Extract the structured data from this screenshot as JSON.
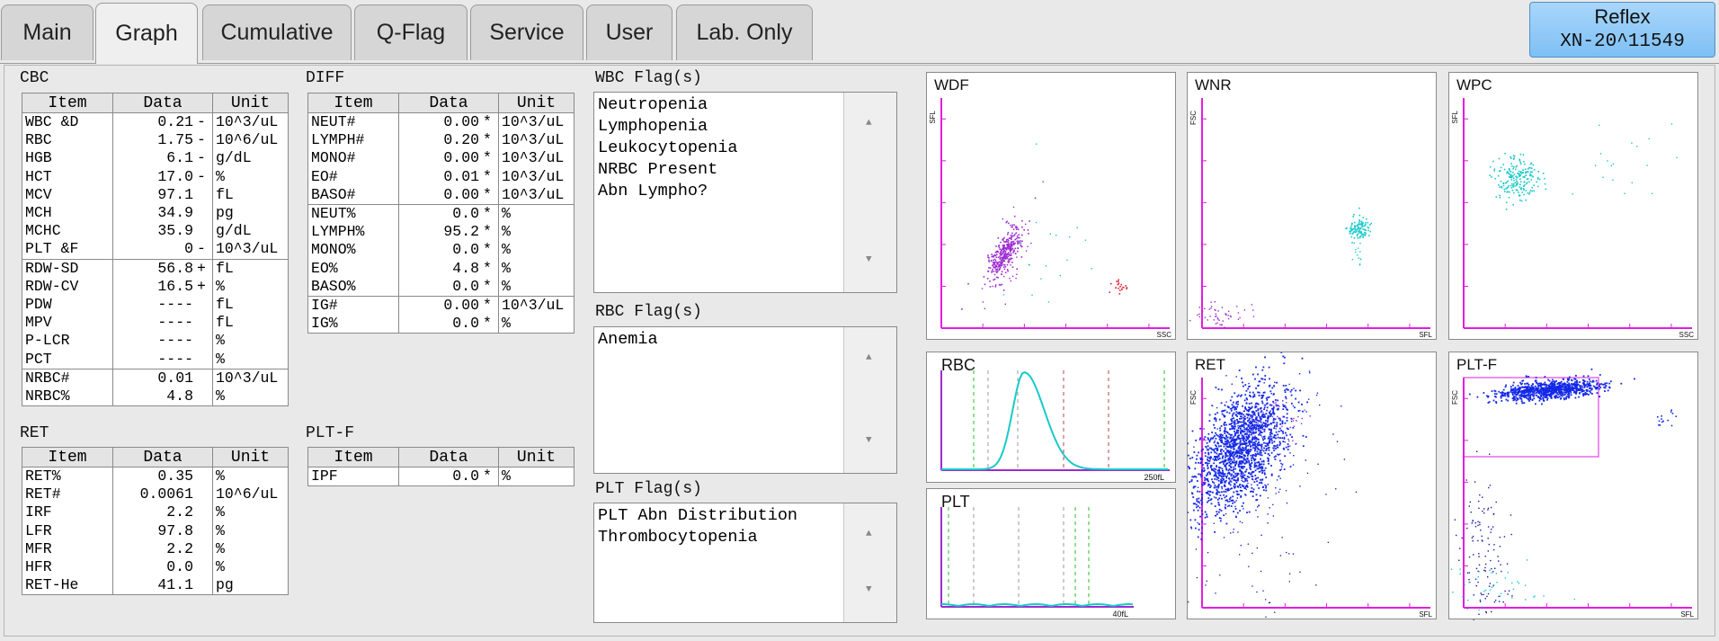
{
  "tabs": [
    {
      "label": "Main",
      "active": false
    },
    {
      "label": "Graph",
      "active": true
    },
    {
      "label": "Cumulative",
      "active": false
    },
    {
      "label": "Q-Flag",
      "active": false
    },
    {
      "label": "Service",
      "active": false
    },
    {
      "label": "User",
      "active": false
    },
    {
      "label": "Lab. Only",
      "active": false
    }
  ],
  "reflex": {
    "label": "Reflex",
    "analyzer": "XN-20^11549"
  },
  "table_headers": {
    "item": "Item",
    "data": "Data",
    "unit": "Unit"
  },
  "cbc": {
    "title": "CBC",
    "rows": [
      {
        "item": "WBC &D",
        "data": "0.21",
        "flag": "-",
        "unit": "10^3/uL"
      },
      {
        "item": "RBC",
        "data": "1.75",
        "flag": "-",
        "unit": "10^6/uL"
      },
      {
        "item": "HGB",
        "data": "6.1",
        "flag": "-",
        "unit": "g/dL"
      },
      {
        "item": "HCT",
        "data": "17.0",
        "flag": "-",
        "unit": "%"
      },
      {
        "item": "MCV",
        "data": "97.1",
        "flag": "",
        "unit": "fL"
      },
      {
        "item": "MCH",
        "data": "34.9",
        "flag": "",
        "unit": "pg"
      },
      {
        "item": "MCHC",
        "data": "35.9",
        "flag": "",
        "unit": "g/dL"
      },
      {
        "item": "PLT &F",
        "data": "0",
        "flag": "-",
        "unit": "10^3/uL"
      },
      {
        "item": "RDW-SD",
        "data": "56.8",
        "flag": "+",
        "unit": "fL"
      },
      {
        "item": "RDW-CV",
        "data": "16.5",
        "flag": "+",
        "unit": "%"
      },
      {
        "item": "PDW",
        "data": "----",
        "flag": "",
        "unit": "fL"
      },
      {
        "item": "MPV",
        "data": "----",
        "flag": "",
        "unit": "fL"
      },
      {
        "item": "P-LCR",
        "data": "----",
        "flag": "",
        "unit": "%"
      },
      {
        "item": "PCT",
        "data": "----",
        "flag": "",
        "unit": "%"
      },
      {
        "item": "NRBC#",
        "data": "0.01",
        "flag": "",
        "unit": "10^3/uL"
      },
      {
        "item": "NRBC%",
        "data": "4.8",
        "flag": "",
        "unit": "%"
      }
    ]
  },
  "diff": {
    "title": "DIFF",
    "rows": [
      {
        "item": "NEUT#",
        "data": "0.00",
        "flag": "*",
        "unit": "10^3/uL"
      },
      {
        "item": "LYMPH#",
        "data": "0.20",
        "flag": "*",
        "unit": "10^3/uL"
      },
      {
        "item": "MONO#",
        "data": "0.00",
        "flag": "*",
        "unit": "10^3/uL"
      },
      {
        "item": "EO#",
        "data": "0.01",
        "flag": "*",
        "unit": "10^3/uL"
      },
      {
        "item": "BASO#",
        "data": "0.00",
        "flag": "*",
        "unit": "10^3/uL"
      },
      {
        "item": "NEUT%",
        "data": "0.0",
        "flag": "*",
        "unit": "%"
      },
      {
        "item": "LYMPH%",
        "data": "95.2",
        "flag": "*",
        "unit": "%"
      },
      {
        "item": "MONO%",
        "data": "0.0",
        "flag": "*",
        "unit": "%"
      },
      {
        "item": "EO%",
        "data": "4.8",
        "flag": "*",
        "unit": "%"
      },
      {
        "item": "BASO%",
        "data": "0.0",
        "flag": "*",
        "unit": "%"
      },
      {
        "item": "IG#",
        "data": "0.00",
        "flag": "*",
        "unit": "10^3/uL"
      },
      {
        "item": "IG%",
        "data": "0.0",
        "flag": "*",
        "unit": "%"
      }
    ]
  },
  "ret": {
    "title": "RET",
    "rows": [
      {
        "item": "RET%",
        "data": "0.35",
        "flag": "",
        "unit": "%"
      },
      {
        "item": "RET#",
        "data": "0.0061",
        "flag": "",
        "unit": "10^6/uL"
      },
      {
        "item": "IRF",
        "data": "2.2",
        "flag": "",
        "unit": "%"
      },
      {
        "item": "LFR",
        "data": "97.8",
        "flag": "",
        "unit": "%"
      },
      {
        "item": "MFR",
        "data": "2.2",
        "flag": "",
        "unit": "%"
      },
      {
        "item": "HFR",
        "data": "0.0",
        "flag": "",
        "unit": "%"
      },
      {
        "item": "RET-He",
        "data": "41.1",
        "flag": "",
        "unit": "pg"
      }
    ]
  },
  "pltf": {
    "title": "PLT-F",
    "rows": [
      {
        "item": "IPF",
        "data": "0.0",
        "flag": "*",
        "unit": "%"
      }
    ]
  },
  "flags": {
    "wbc": {
      "title": "WBC Flag(s)",
      "items": [
        "Neutropenia",
        "Lymphopenia",
        "Leukocytopenia",
        "NRBC Present",
        "Abn Lympho?"
      ]
    },
    "rbc": {
      "title": "RBC Flag(s)",
      "items": [
        "Anemia"
      ]
    },
    "plt": {
      "title": "PLT Flag(s)",
      "items": [
        "PLT Abn Distribution",
        "Thrombocytopenia"
      ]
    }
  },
  "graphs": {
    "wdf": {
      "title": "WDF",
      "x_axis": "SSC",
      "y_axis": "SFL"
    },
    "wnr": {
      "title": "WNR",
      "x_axis": "SFL",
      "y_axis": "FSC"
    },
    "wpc": {
      "title": "WPC",
      "x_axis": "SSC",
      "y_axis": "SFL"
    },
    "ret": {
      "title": "RET",
      "x_axis": "SFL",
      "y_axis": "FSC"
    },
    "pltf": {
      "title": "PLT-F",
      "x_axis": "SFL",
      "y_axis": "FSC"
    },
    "rbc": {
      "title": "RBC",
      "x_max": "250fL"
    },
    "plt": {
      "title": "PLT",
      "x_max": "40fL"
    }
  },
  "colors": {
    "axis": "#e21de0",
    "lymph": "#9c2bd0",
    "eo": "#e0263c",
    "cyan": "#18c9c9",
    "blue": "#1428e6",
    "navy": "#141a9c"
  }
}
